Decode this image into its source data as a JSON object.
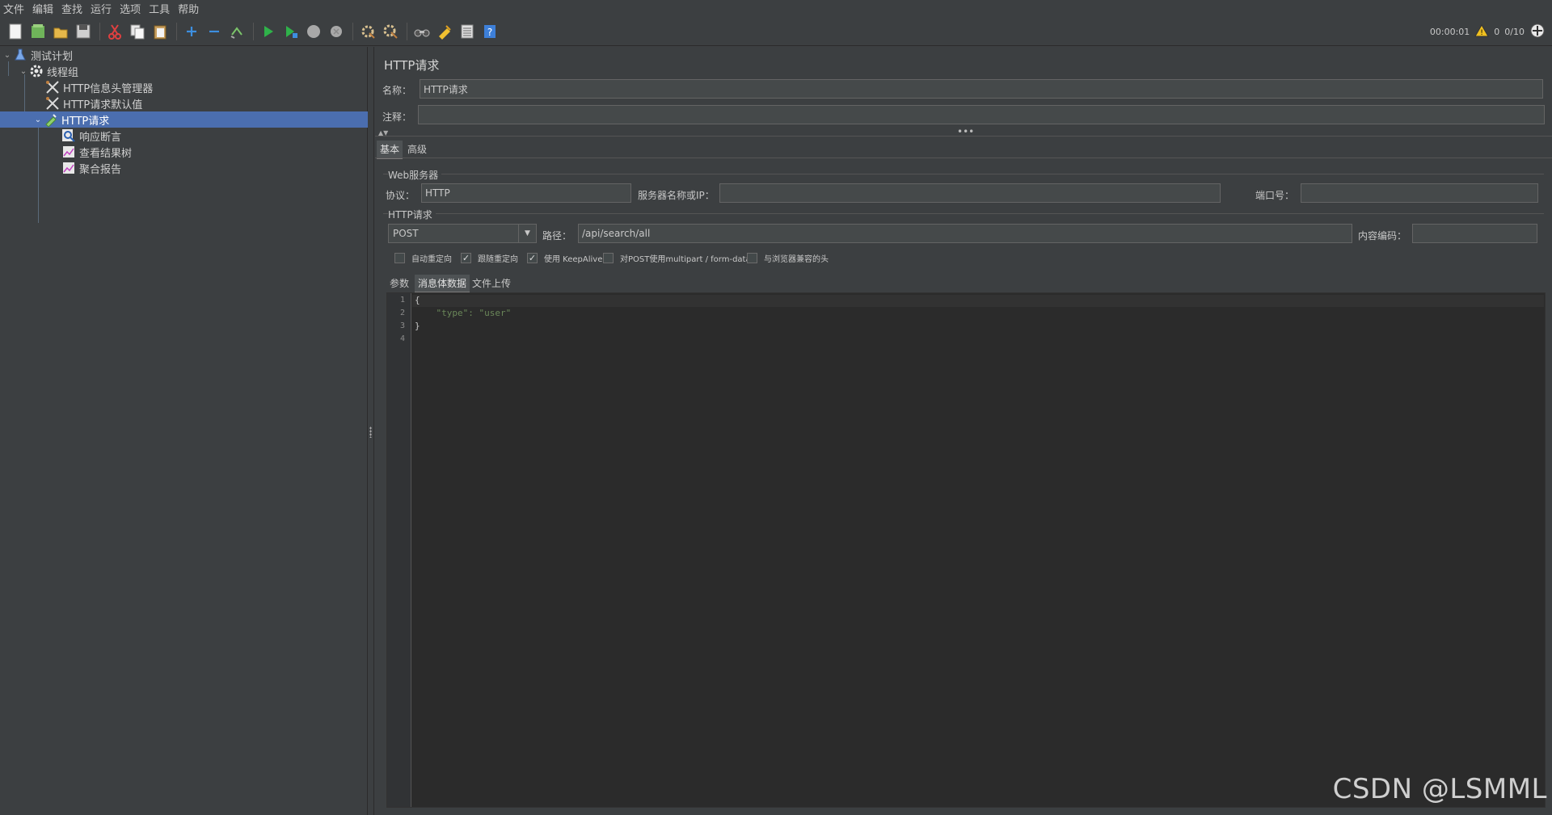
{
  "menu": [
    "文件",
    "编辑",
    "查找",
    "运行",
    "选项",
    "工具",
    "帮助"
  ],
  "toolbar": {
    "timer": "00:00:01",
    "warnings": "0",
    "threads": "0/10"
  },
  "tree": {
    "items": [
      {
        "label": "测试计划",
        "icon": "flask-icon"
      },
      {
        "label": "线程组",
        "icon": "gear-icon"
      },
      {
        "label": "HTTP信息头管理器",
        "icon": "wrench-icon"
      },
      {
        "label": "HTTP请求默认值",
        "icon": "wrench-icon"
      },
      {
        "label": "HTTP请求",
        "icon": "pipette-icon"
      },
      {
        "label": "响应断言",
        "icon": "magnifier-icon"
      },
      {
        "label": "查看结果树",
        "icon": "chart-icon"
      },
      {
        "label": "聚合报告",
        "icon": "chart-icon"
      }
    ]
  },
  "panel": {
    "title": "HTTP请求",
    "name_label": "名称：",
    "name_value": "HTTP请求",
    "comment_label": "注释：",
    "comment_value": "",
    "tabs": [
      "基本",
      "高级"
    ],
    "web_server": {
      "title": "Web服务器",
      "protocol_label": "协议：",
      "protocol_value": "HTTP",
      "server_label": "服务器名称或IP：",
      "server_value": "",
      "port_label": "端口号：",
      "port_value": ""
    },
    "http_request": {
      "title": "HTTP请求",
      "method": "POST",
      "path_label": "路径：",
      "path_value": "/api/search/all",
      "encoding_label": "内容编码：",
      "encoding_value": ""
    },
    "checkboxes": [
      {
        "label": "自动重定向",
        "checked": false
      },
      {
        "label": "跟随重定向",
        "checked": true
      },
      {
        "label": "使用 KeepAlive",
        "checked": true
      },
      {
        "label": "对POST使用multipart / form-data",
        "checked": false
      },
      {
        "label": "与浏览器兼容的头",
        "checked": false
      }
    ],
    "body_tabs": [
      "参数",
      "消息体数据",
      "文件上传"
    ],
    "editor": {
      "line_numbers": [
        "1",
        "2",
        "3",
        "4"
      ],
      "lines": [
        "{",
        "    \"type\": \"user\"",
        "}",
        ""
      ]
    }
  },
  "watermark": "CSDN @LSMML"
}
